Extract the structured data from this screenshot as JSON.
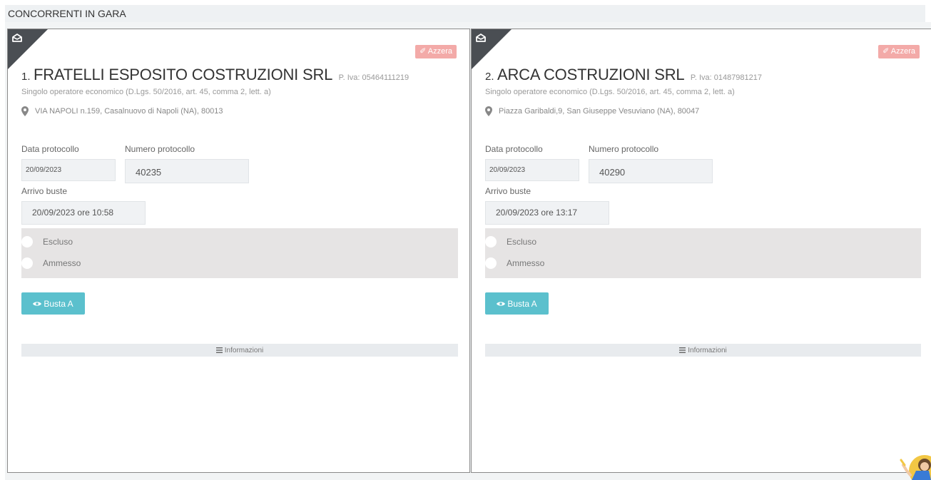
{
  "section": {
    "title": "CONCORRENTI IN GARA"
  },
  "competitors": [
    {
      "index": "1.",
      "name": "FRATELLI ESPOSITO COSTRUZIONI SRL",
      "piva": "P. Iva: 05464111219",
      "type": "Singolo operatore economico (D.Lgs. 50/2016, art. 45, comma 2, lett. a)",
      "address": "VIA NAPOLI n.159, Casalnuovo di Napoli (NA), 80013",
      "reset_label": "Azzera",
      "data_protocollo_label": "Data protocollo",
      "data_protocollo": "20/09/2023",
      "numero_protocollo_label": "Numero protocollo",
      "numero_protocollo": "40235",
      "arrivo_label": "Arrivo buste",
      "arrivo": "20/09/2023 ore 10:58",
      "option_escluso": "Escluso",
      "option_ammesso": "Ammesso",
      "busta_label": "Busta A",
      "info_label": "Informazioni"
    },
    {
      "index": "2.",
      "name": "ARCA COSTRUZIONI SRL",
      "piva": "P. Iva: 01487981217",
      "type": "Singolo operatore economico (D.Lgs. 50/2016, art. 45, comma 2, lett. a)",
      "address": "Piazza Garibaldi,9, San Giuseppe Vesuviano (NA), 80047",
      "reset_label": "Azzera",
      "data_protocollo_label": "Data protocollo",
      "data_protocollo": "20/09/2023",
      "numero_protocollo_label": "Numero protocollo",
      "numero_protocollo": "40290",
      "arrivo_label": "Arrivo buste",
      "arrivo": "20/09/2023 ore 13:17",
      "option_escluso": "Escluso",
      "option_ammesso": "Ammesso",
      "busta_label": "Busta A",
      "info_label": "Informazioni"
    }
  ],
  "icons": {
    "corner": "envelope-open-icon",
    "reset": "eraser-icon",
    "address": "map-marker-icon",
    "busta": "eye-icon",
    "info": "bars-icon",
    "assistant": "assistant-avatar-icon"
  },
  "colors": {
    "reset_button": "#f3aaa8",
    "busta_button": "#5bc0cd",
    "corner": "#4a4e53",
    "radio_panel": "#e6e4e4"
  }
}
